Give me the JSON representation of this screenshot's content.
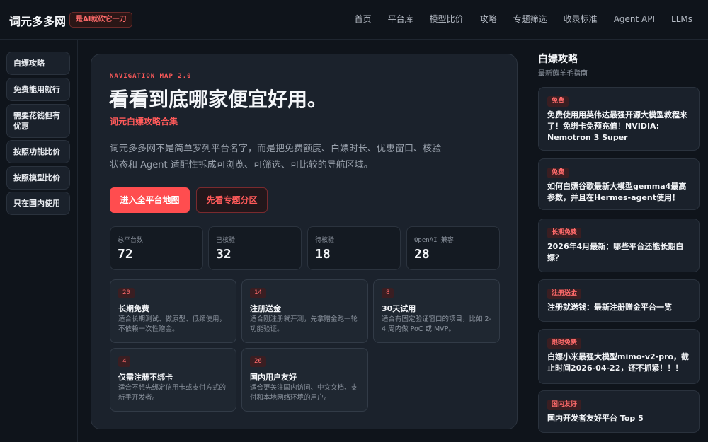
{
  "header": {
    "brand": "词元多多网",
    "badge": "是AI就砍它一刀",
    "nav": [
      "首页",
      "平台库",
      "模型比价",
      "攻略",
      "专题筛选",
      "收录标准",
      "Agent API",
      "LLMs"
    ]
  },
  "sidebar": {
    "items": [
      "白嫖攻略",
      "免费能用就行",
      "需要花钱但有优惠",
      "按照功能比价",
      "按照模型比价",
      "只在国内使用"
    ]
  },
  "hero": {
    "eyebrow": "NAVIGATION MAP 2.0",
    "title": "看看到底哪家便宜好用。",
    "subtitle": "词元白嫖攻略合集",
    "description": "词元多多网不是简单罗列平台名字，而是把免费额度、白嫖时长、优惠窗口、核验状态和 Agent 适配性拆成可浏览、可筛选、可比较的导航区域。",
    "primary_button": "进入全平台地图",
    "secondary_button": "先看专题分区"
  },
  "stats": [
    {
      "label": "总平台数",
      "value": "72"
    },
    {
      "label": "已核验",
      "value": "32"
    },
    {
      "label": "待核验",
      "value": "18"
    },
    {
      "label": "OpenAI 兼容",
      "value": "28"
    }
  ],
  "topics": [
    {
      "count": "20",
      "title": "长期免费",
      "desc": "适合长期测试、做原型、低频使用，不依赖一次性赠金。"
    },
    {
      "count": "14",
      "title": "注册送金",
      "desc": "适合刚注册就开测，先拿赠金跑一轮功能验证。"
    },
    {
      "count": "8",
      "title": "30天试用",
      "desc": "适合有固定验证窗口的项目，比如 2-4 周内做 PoC 或 MVP。"
    },
    {
      "count": "4",
      "title": "仅需注册不绑卡",
      "desc": "适合不想先绑定信用卡或支付方式的新手开发者。"
    },
    {
      "count": "26",
      "title": "国内用户友好",
      "desc": "适合更关注国内访问、中文文档、支付和本地网络环境的用户。"
    }
  ],
  "guides": {
    "title": "白嫖攻略",
    "subtitle": "最新薅羊毛指南",
    "items": [
      {
        "tag": "免费",
        "title": "免费使用用英伟达最强开源大模型教程来了！免绑卡免预充值！NVIDIA: Nemotron 3 Super"
      },
      {
        "tag": "免费",
        "title": "如何白嫖谷歌最新大模型gemma4最高参数，并且在Hermes-agent使用！"
      },
      {
        "tag": "长期免费",
        "title": "2026年4月最新：哪些平台还能长期白嫖？"
      },
      {
        "tag": "注册送金",
        "title": "注册就送钱：最新注册赠金平台一览"
      },
      {
        "tag": "限时免费",
        "title": "白嫖小米最强大模型mimo-v2-pro，截止时间2026-04-22，还不抓紧！！！"
      },
      {
        "tag": "国内友好",
        "title": "国内开发者友好平台 Top 5"
      }
    ]
  }
}
